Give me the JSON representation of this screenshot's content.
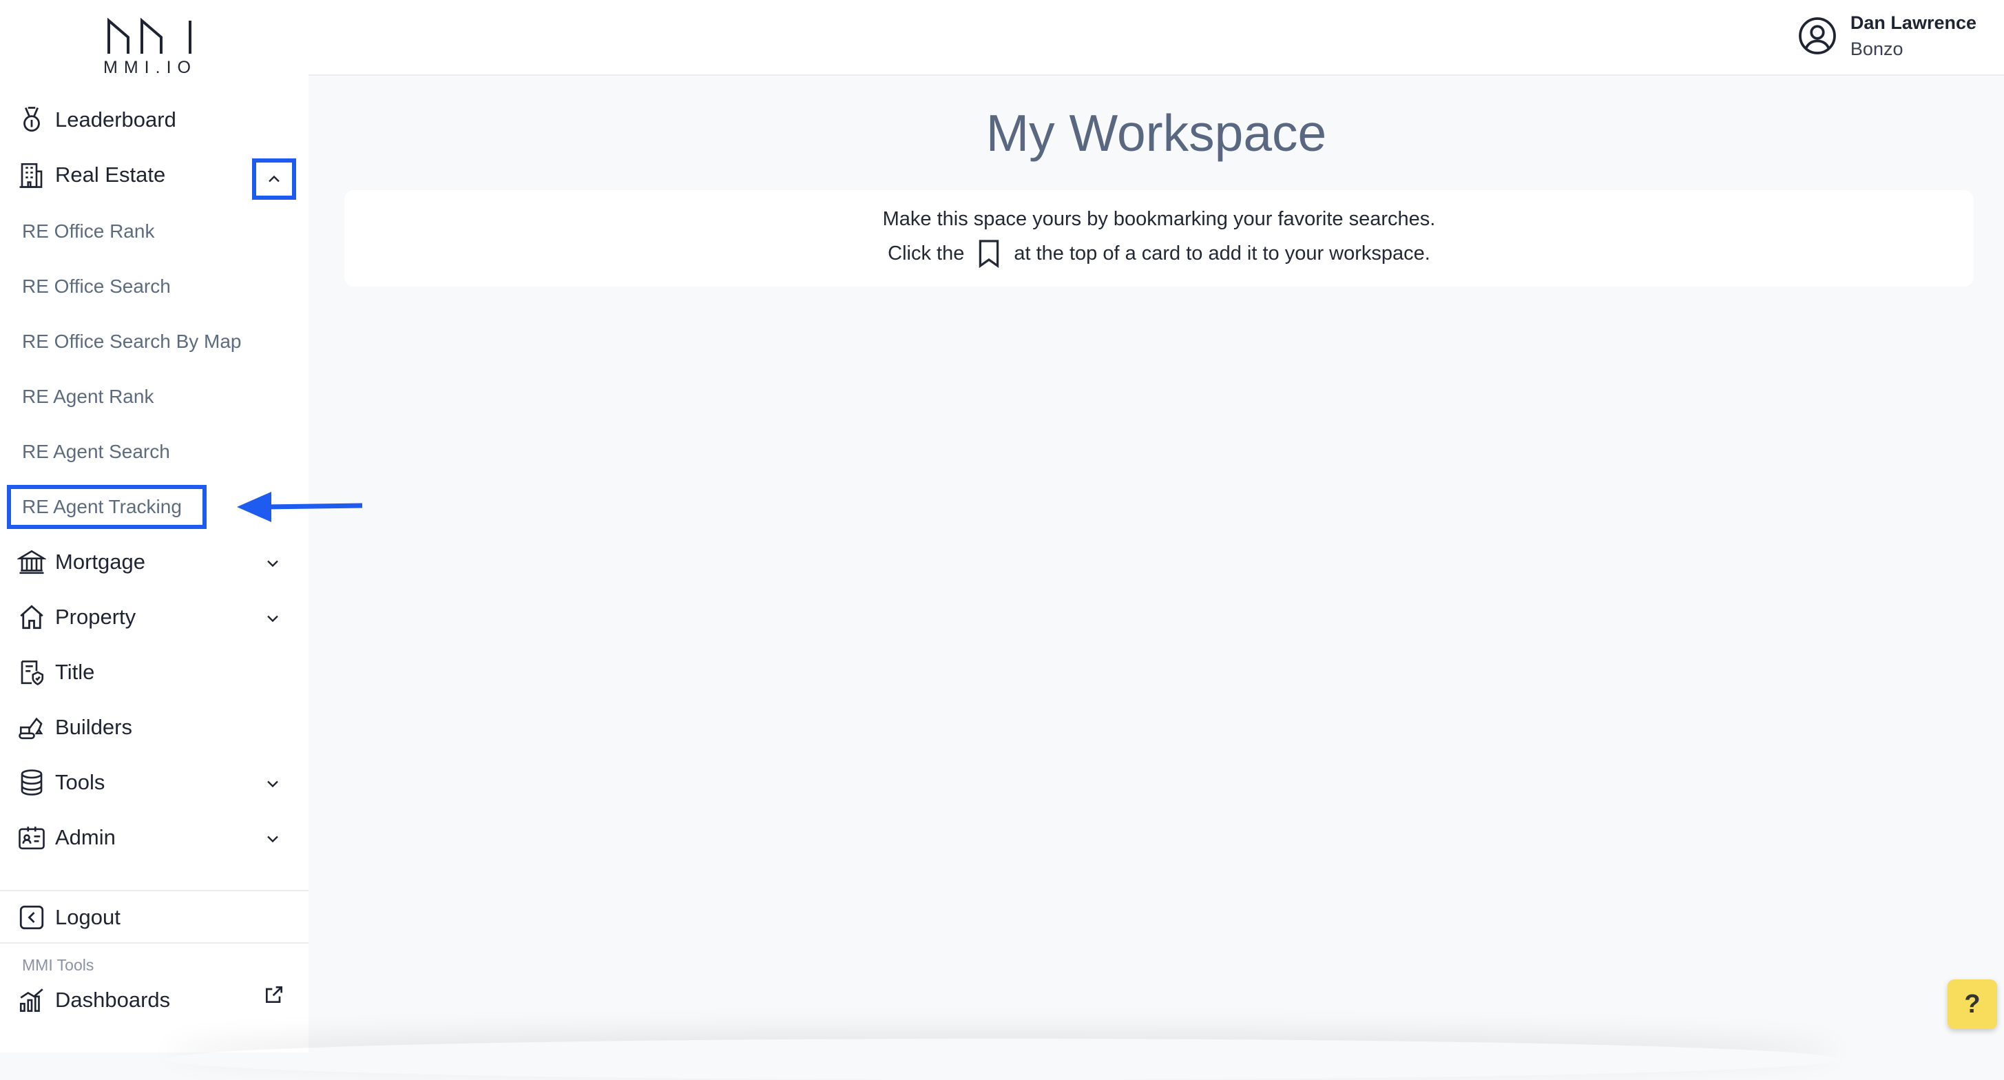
{
  "logo": {
    "text": "MMI.IO"
  },
  "user": {
    "name": "Dan Lawrence",
    "org": "Bonzo"
  },
  "main": {
    "title": "My Workspace",
    "card_line1": "Make this space yours by bookmarking your favorite searches.",
    "card_line2_before": "Click the",
    "card_line2_after": "at the top of a card to add it to your workspace."
  },
  "sidebar": {
    "items": [
      {
        "label": "Leaderboard",
        "icon": "medal-icon"
      },
      {
        "label": "Real Estate",
        "icon": "building-icon",
        "expanded": true
      },
      {
        "label": "Mortgage",
        "icon": "bank-icon"
      },
      {
        "label": "Property",
        "icon": "house-icon"
      },
      {
        "label": "Title",
        "icon": "title-badge-icon"
      },
      {
        "label": "Builders",
        "icon": "excavator-icon"
      },
      {
        "label": "Tools",
        "icon": "database-icon"
      },
      {
        "label": "Admin",
        "icon": "id-card-icon"
      }
    ],
    "real_estate_sub": [
      "RE Office Rank",
      "RE Office Search",
      "RE Office Search By Map",
      "RE Agent Rank",
      "RE Agent Search",
      "RE Agent Tracking"
    ],
    "logout": "Logout",
    "section_label": "MMI Tools",
    "dashboards": "Dashboards"
  },
  "help": {
    "label": "?"
  },
  "colors": {
    "highlight": "#1e5bf0",
    "help_bg": "#f8dd5c",
    "title": "#5a6780"
  }
}
